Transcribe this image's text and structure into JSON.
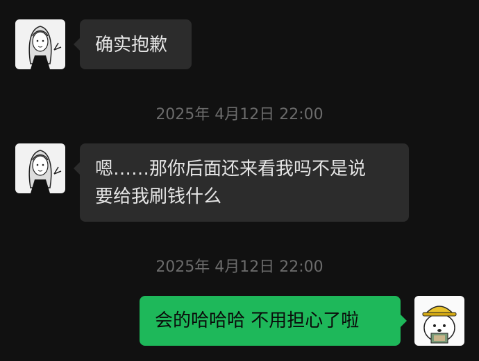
{
  "messages": [
    {
      "sender": "other",
      "text": "确实抱歉"
    },
    {
      "timestamp": "2025年 4月12日 22:00"
    },
    {
      "sender": "other",
      "text_line1": "嗯……那你后面还来看我吗不是说",
      "text_line2": "要给我刷钱什么"
    },
    {
      "timestamp": "2025年 4月12日 22:00"
    },
    {
      "sender": "me",
      "text": "会的哈哈哈 不用担心了啦"
    }
  ],
  "colors": {
    "background": "#111111",
    "incoming_bubble": "#2c2c2c",
    "outgoing_bubble": "#1eb85a",
    "timestamp_text": "#6b6b6b"
  },
  "avatars": {
    "other": "avatar-sketch-girl-icon",
    "me": "avatar-dog-with-hat-icon"
  }
}
